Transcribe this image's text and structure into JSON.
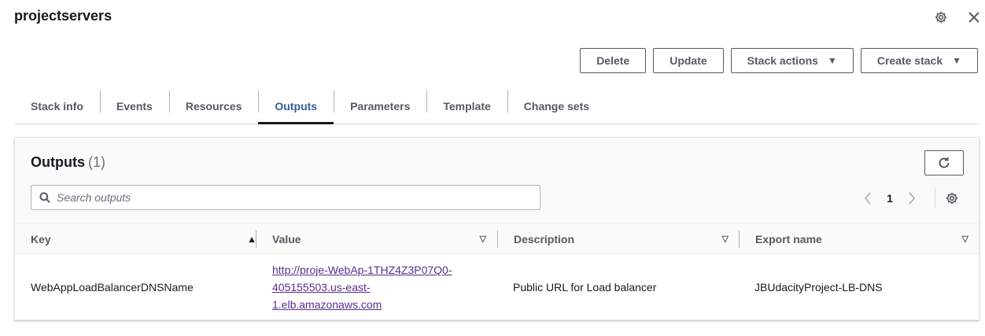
{
  "header": {
    "title": "projectservers",
    "settings_icon": "gear-icon",
    "close_icon": "close-icon"
  },
  "actions": {
    "delete": "Delete",
    "update": "Update",
    "stack_actions": "Stack actions",
    "create_stack": "Create stack"
  },
  "tabs": [
    {
      "label": "Stack info"
    },
    {
      "label": "Events"
    },
    {
      "label": "Resources"
    },
    {
      "label": "Outputs",
      "active": true
    },
    {
      "label": "Parameters"
    },
    {
      "label": "Template"
    },
    {
      "label": "Change sets"
    }
  ],
  "outputs": {
    "title": "Outputs",
    "count": "(1)",
    "search_placeholder": "Search outputs",
    "page": "1",
    "columns": {
      "key": "Key",
      "value": "Value",
      "description": "Description",
      "export_name": "Export name"
    },
    "rows": [
      {
        "key": "WebAppLoadBalancerDNSName",
        "value_line1": "http://proje-WebAp-1THZ4Z3P07Q0-",
        "value_line2": "405155503.us-east-",
        "value_line3": "1.elb.amazonaws.com",
        "description": "Public URL for Load balancer",
        "export_name": "JBUdacityProject-LB-DNS"
      }
    ]
  },
  "colors": {
    "active_tab": "#2f5f9e",
    "link": "#5a2d8f",
    "border": "#545b64"
  }
}
